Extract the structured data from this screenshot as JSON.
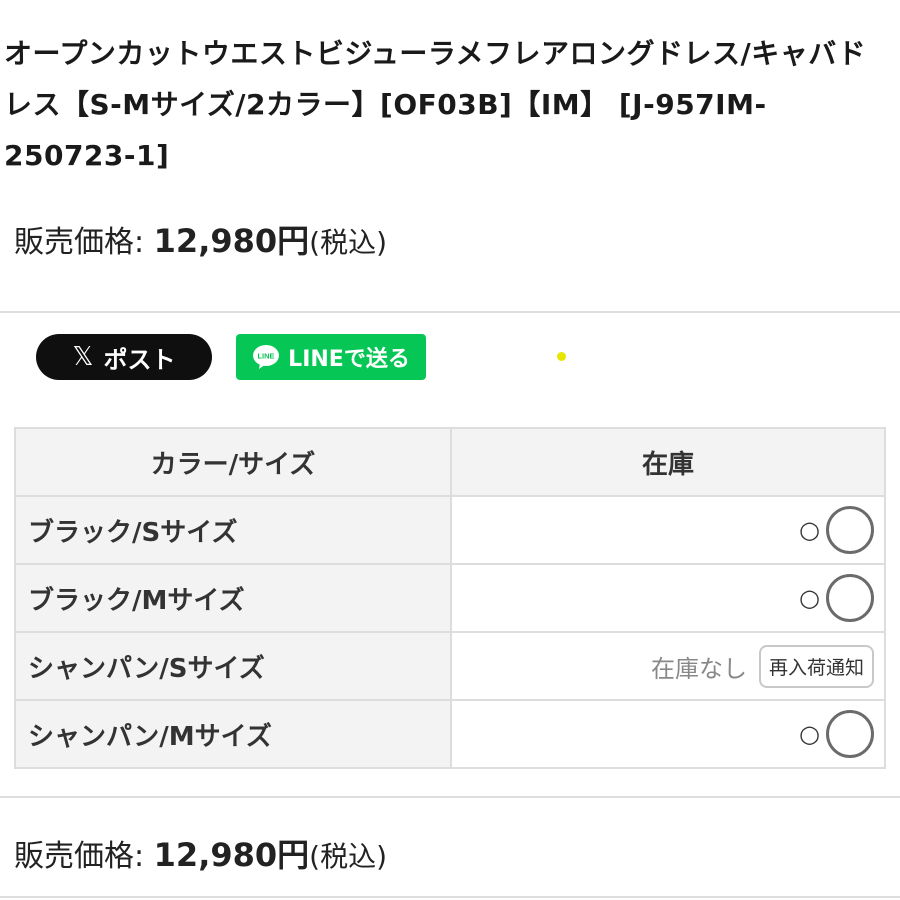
{
  "product": {
    "title": "オープンカットウエストビジューラメフレアロングドレス/キャバドレス【S-Mサイズ/2カラー】[OF03B]【IM】 [J-957IM-250723-1]"
  },
  "price": {
    "label": "販売価格: ",
    "value": "12,980円",
    "tax": "(税込)"
  },
  "share": {
    "x_icon": "x-logo-icon",
    "x_glyph": "𝕏",
    "x_label": "ポスト",
    "line_icon": "line-logo-icon",
    "line_badge": "LINE",
    "line_label": "LINEで送る"
  },
  "stock_table": {
    "headers": [
      "カラー/サイズ",
      "在庫"
    ],
    "rows": [
      {
        "variant": "ブラック/Sサイズ",
        "stock": "○",
        "in_stock": true
      },
      {
        "variant": "ブラック/Mサイズ",
        "stock": "○",
        "in_stock": true
      },
      {
        "variant": "シャンパン/Sサイズ",
        "stock": "在庫なし",
        "in_stock": false,
        "button": "再入荷通知"
      },
      {
        "variant": "シャンパン/Mサイズ",
        "stock": "○",
        "in_stock": true
      }
    ]
  },
  "colors": {
    "line_green": "#06c755",
    "x_black": "#0f0f0f",
    "border": "#dddddd",
    "header_bg": "#f3f3f3"
  }
}
